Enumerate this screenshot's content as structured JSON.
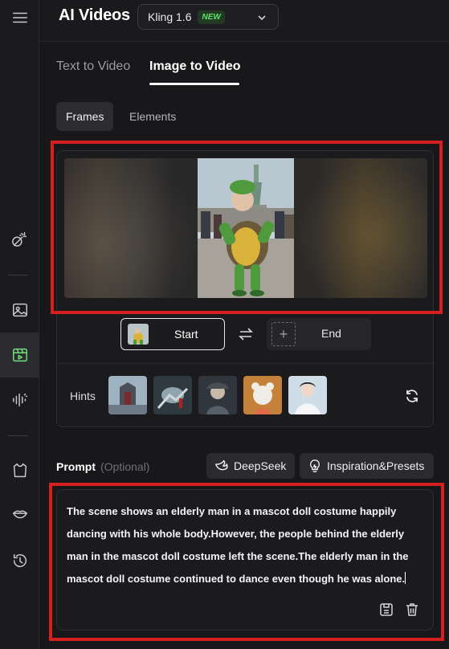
{
  "app": {
    "title": "AI Videos"
  },
  "model": {
    "name": "Kling 1.6",
    "badge": "NEW"
  },
  "tabs": [
    {
      "label": "Text to Video"
    },
    {
      "label": "Image to Video"
    }
  ],
  "subtabs": [
    {
      "label": "Frames"
    },
    {
      "label": "Elements"
    }
  ],
  "frames": {
    "start_label": "Start",
    "end_label": "End"
  },
  "hints": {
    "label": "Hints"
  },
  "prompt": {
    "title": "Prompt",
    "optional": "(Optional)",
    "deepseek_label": "DeepSeek",
    "inspiration_label": "Inspiration&Presets",
    "text": "The scene shows an elderly man in a mascot doll costume happily dancing with his whole body.However, the people behind the elderly man in the mascot doll costume left the scene.The elderly man in the mascot doll costume continued to dance even though he was alone."
  },
  "colors": {
    "accent": "#6fe07a",
    "annotation": "#d61f1f",
    "badge_text": "#5ee36b"
  }
}
